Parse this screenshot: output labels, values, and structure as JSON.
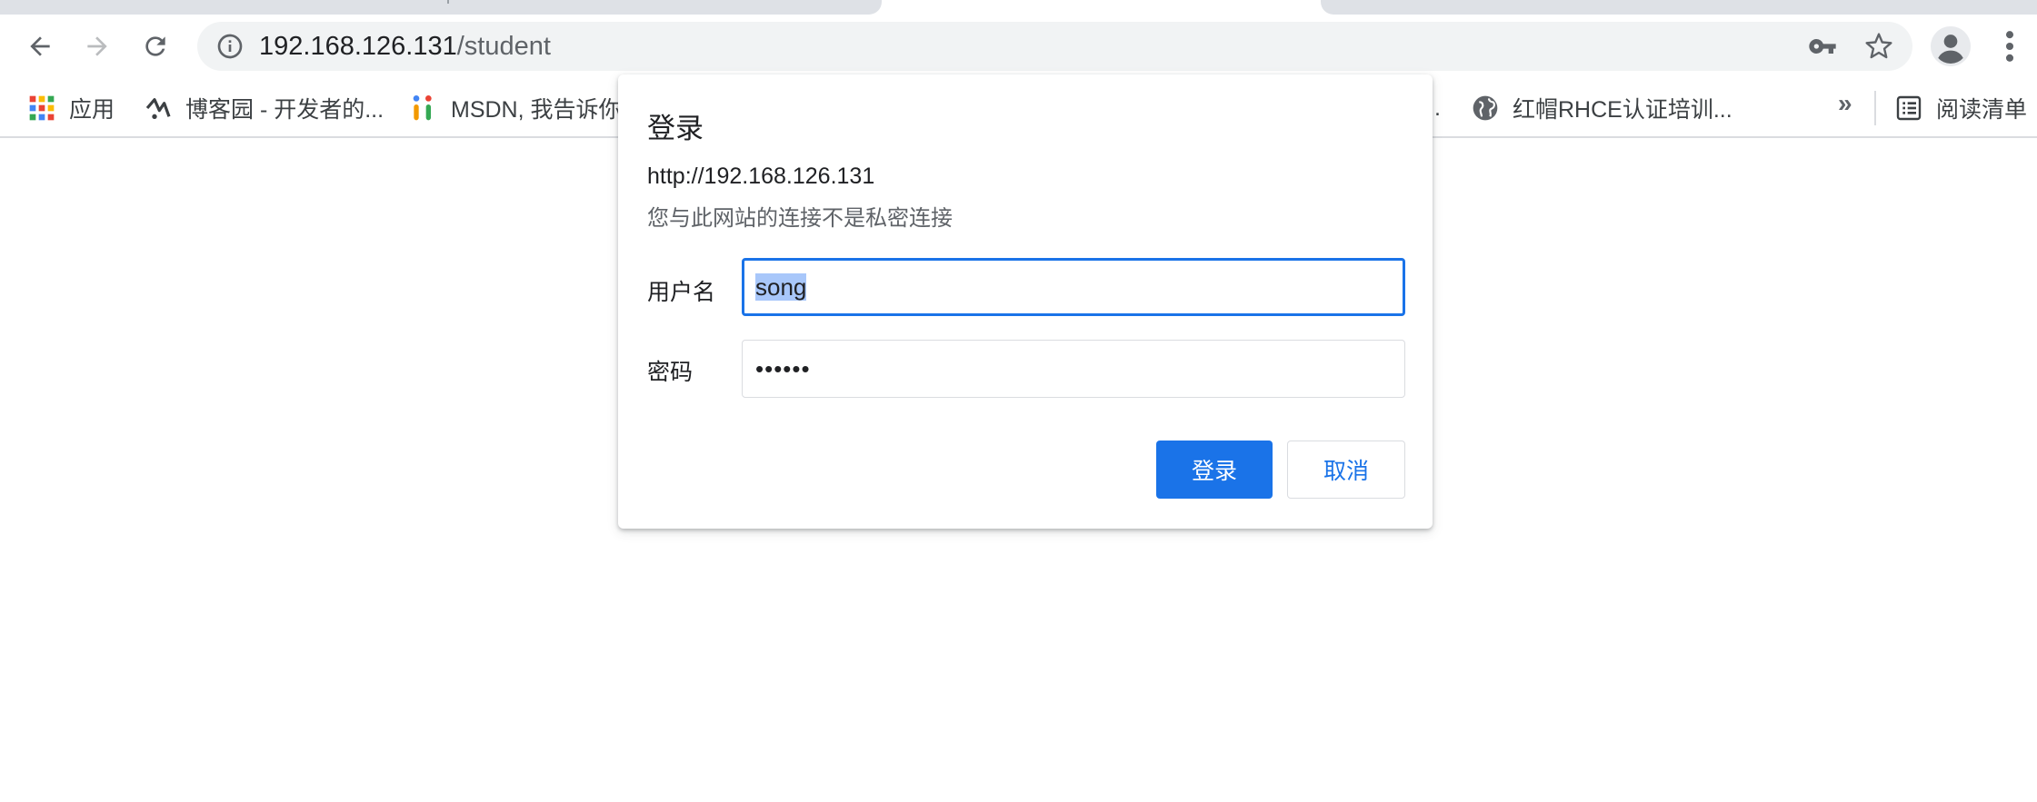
{
  "browser": {
    "url_host": "192.168.126.131",
    "url_path": "/student"
  },
  "bookmarks": [
    {
      "label": "应用",
      "icon": "apps-grid-icon"
    },
    {
      "label": "博客园 - 开发者的...",
      "icon": "cnblogs-icon"
    },
    {
      "label": "MSDN, 我告诉你",
      "icon": "msdn-icon"
    },
    {
      "label": "红帽RHCE认证培训...",
      "icon": "globe-icon"
    }
  ],
  "bookmarks_more": "»",
  "reading_list": {
    "label": "阅读清单",
    "icon": "reading-list-icon"
  },
  "truncated_bookmark_tail": ".",
  "dialog": {
    "title": "登录",
    "origin": "http://192.168.126.131",
    "warning": "您与此网站的连接不是私密连接",
    "username_label": "用户名",
    "username_value": "song",
    "password_label": "密码",
    "password_mask": "••••••",
    "login_button": "登录",
    "cancel_button": "取消"
  },
  "colors": {
    "accent": "#1a73e8",
    "selection": "#a8c7fa",
    "omnibox_bg": "#f1f3f4"
  }
}
